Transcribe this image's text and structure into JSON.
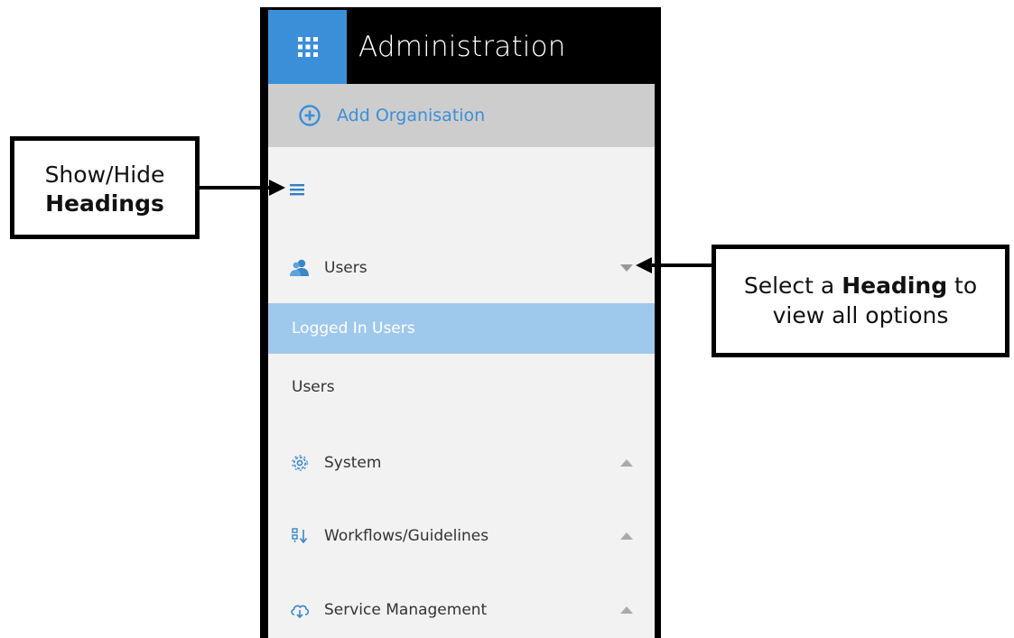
{
  "header": {
    "title": "Administration",
    "grid_icon": "apps-grid-icon",
    "accent": "#3b8fd9"
  },
  "add_org": {
    "label": "Add Organisation",
    "icon": "plus-circle-icon"
  },
  "menu_toggle": {
    "icon": "hamburger-menu-icon"
  },
  "nav": {
    "users": {
      "label": "Users",
      "icon": "users-icon",
      "expanded": true,
      "items": [
        {
          "label": "Logged In Users",
          "active": true
        },
        {
          "label": "Users",
          "active": false
        }
      ]
    },
    "system": {
      "label": "System",
      "icon": "gear-icon"
    },
    "workflows": {
      "label": "Workflows/Guidelines",
      "icon": "sort-icon"
    },
    "service": {
      "label": "Service Management",
      "icon": "cloud-icon"
    }
  },
  "callouts": {
    "left": {
      "line1": "Show/Hide",
      "line2_bold": "Headings"
    },
    "right": {
      "pre": "Select a ",
      "bold": "Heading",
      "post": " to",
      "line2": "view all options"
    }
  },
  "colors": {
    "active_row": "#9fc9ec",
    "header_bg": "#000000",
    "add_org_bg": "#cdcdcd",
    "sidebar_bg": "#f2f2f2"
  }
}
